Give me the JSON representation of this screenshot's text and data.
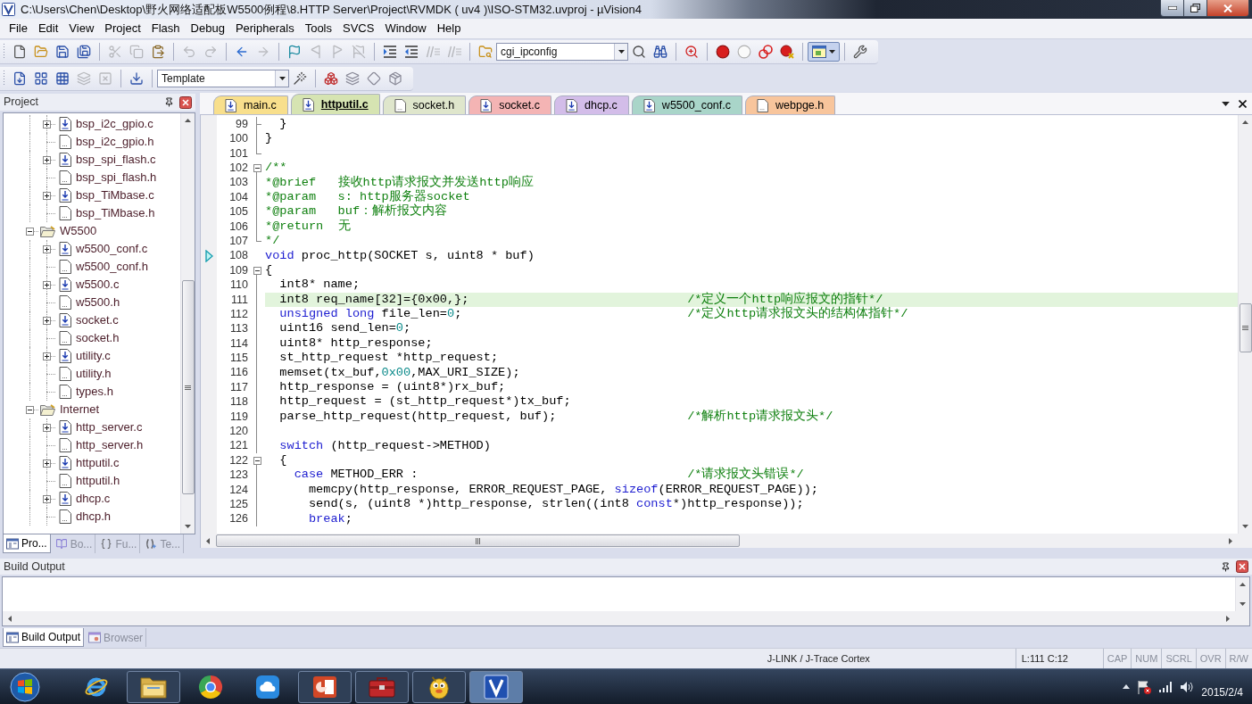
{
  "window": {
    "title": "C:\\Users\\Chen\\Desktop\\野火网络适配板W5500例程\\8.HTTP Server\\Project\\RVMDK ( uv4 )\\ISO-STM32.uvproj - µVision4"
  },
  "menu": [
    "File",
    "Edit",
    "View",
    "Project",
    "Flash",
    "Debug",
    "Peripherals",
    "Tools",
    "SVCS",
    "Window",
    "Help"
  ],
  "toolbar_1": [
    {
      "kind": "new",
      "disabled": false,
      "pressed": false
    },
    {
      "kind": "open",
      "disabled": false,
      "pressed": false
    },
    {
      "kind": "save",
      "disabled": false,
      "pressed": false
    },
    {
      "kind": "save_all",
      "disabled": false,
      "pressed": false
    },
    {
      "kind": "separator"
    },
    {
      "kind": "cut",
      "disabled": true,
      "pressed": false
    },
    {
      "kind": "copy",
      "disabled": true,
      "pressed": false
    },
    {
      "kind": "paste",
      "disabled": false,
      "pressed": false
    },
    {
      "kind": "separator"
    },
    {
      "kind": "undo",
      "disabled": true,
      "pressed": false
    },
    {
      "kind": "redo",
      "disabled": true,
      "pressed": false
    },
    {
      "kind": "separator"
    },
    {
      "kind": "back",
      "disabled": false,
      "pressed": false
    },
    {
      "kind": "forward",
      "disabled": true,
      "pressed": false
    },
    {
      "kind": "separator"
    },
    {
      "kind": "bookmark",
      "disabled": false,
      "pressed": false
    },
    {
      "kind": "prev_bookmark",
      "disabled": true,
      "pressed": false
    },
    {
      "kind": "next_bookmark",
      "disabled": true,
      "pressed": false
    },
    {
      "kind": "clear_bookmarks",
      "disabled": true,
      "pressed": false
    },
    {
      "kind": "separator"
    },
    {
      "kind": "indent",
      "disabled": false,
      "pressed": false
    },
    {
      "kind": "unindent",
      "disabled": false,
      "pressed": false
    },
    {
      "kind": "comment",
      "disabled": true,
      "pressed": false
    },
    {
      "kind": "uncomment",
      "disabled": true,
      "pressed": false
    },
    {
      "kind": "separator"
    },
    {
      "kind": "find_in_files",
      "disabled": false,
      "pressed": false
    },
    {
      "kind": "combo",
      "value": "cgi_ipconfig"
    },
    {
      "kind": "find",
      "disabled": false,
      "pressed": false
    },
    {
      "kind": "incremental_find",
      "disabled": false,
      "pressed": false
    },
    {
      "kind": "separator"
    },
    {
      "kind": "debug",
      "disabled": false,
      "pressed": false
    },
    {
      "kind": "separator"
    },
    {
      "kind": "breakpoint",
      "disabled": false,
      "pressed": false
    },
    {
      "kind": "disable_breakpoint",
      "disabled": false,
      "pressed": false
    },
    {
      "kind": "kill_breakpoints",
      "disabled": false,
      "pressed": false
    },
    {
      "kind": "disable_all_breakpoints",
      "disabled": false,
      "pressed": false
    },
    {
      "kind": "separator"
    },
    {
      "kind": "windows",
      "disabled": false,
      "pressed": true
    },
    {
      "kind": "separator"
    },
    {
      "kind": "configure",
      "disabled": false,
      "pressed": false
    }
  ],
  "toolbar_2": [
    {
      "kind": "translate",
      "disabled": false,
      "pressed": false
    },
    {
      "kind": "build",
      "disabled": false,
      "pressed": false
    },
    {
      "kind": "rebuild",
      "disabled": false,
      "pressed": false
    },
    {
      "kind": "batch_build",
      "disabled": true,
      "pressed": false
    },
    {
      "kind": "stop_build",
      "disabled": true,
      "pressed": false
    },
    {
      "kind": "separator"
    },
    {
      "kind": "download",
      "disabled": false,
      "pressed": false
    },
    {
      "kind": "separator"
    },
    {
      "kind": "combo",
      "value": "Template"
    },
    {
      "kind": "options",
      "disabled": false,
      "pressed": false
    },
    {
      "kind": "separator"
    },
    {
      "kind": "components",
      "disabled": false,
      "pressed": false
    },
    {
      "kind": "stack",
      "disabled": false,
      "pressed": false
    },
    {
      "kind": "diamond",
      "disabled": false,
      "pressed": false
    },
    {
      "kind": "package",
      "disabled": false,
      "pressed": false
    }
  ],
  "project_panel": {
    "title": "Project",
    "tree": [
      {
        "children": [
          {
            "kind": "source",
            "label": "bsp_i2c_gpio.c",
            "expanded": false
          },
          {
            "kind": "header",
            "label": "bsp_i2c_gpio.h"
          },
          {
            "kind": "source",
            "label": "bsp_spi_flash.c",
            "expanded": false
          },
          {
            "kind": "header",
            "label": "bsp_spi_flash.h"
          },
          {
            "kind": "source",
            "label": "bsp_TiMbase.c",
            "expanded": false
          },
          {
            "kind": "header",
            "label": "bsp_TiMbase.h"
          }
        ]
      },
      {
        "kind": "group",
        "label": "W5500",
        "expanded": true,
        "children": [
          {
            "kind": "source",
            "label": "w5500_conf.c",
            "expanded": false
          },
          {
            "kind": "header",
            "label": "w5500_conf.h"
          },
          {
            "kind": "source",
            "label": "w5500.c",
            "expanded": false
          },
          {
            "kind": "header",
            "label": "w5500.h"
          },
          {
            "kind": "source",
            "label": "socket.c",
            "expanded": false
          },
          {
            "kind": "header",
            "label": "socket.h"
          },
          {
            "kind": "source",
            "label": "utility.c",
            "expanded": false
          },
          {
            "kind": "header",
            "label": "utility.h"
          },
          {
            "kind": "header",
            "label": "types.h"
          }
        ]
      },
      {
        "kind": "group",
        "label": "Internet",
        "expanded": true,
        "children": [
          {
            "kind": "source",
            "label": "http_server.c",
            "expanded": false
          },
          {
            "kind": "header",
            "label": "http_server.h"
          },
          {
            "kind": "source",
            "label": "httputil.c",
            "expanded": false
          },
          {
            "kind": "header",
            "label": "httputil.h"
          },
          {
            "kind": "source",
            "label": "dhcp.c",
            "expanded": false
          },
          {
            "kind": "header",
            "label": "dhcp.h"
          }
        ]
      }
    ],
    "tabs": [
      {
        "kind": "project",
        "label": "Pro...",
        "selected": true
      },
      {
        "kind": "books",
        "label": "Bo...",
        "selected": false
      },
      {
        "kind": "functions",
        "label": "Fu...",
        "selected": false
      },
      {
        "kind": "templates",
        "label": "Te...",
        "selected": false
      }
    ]
  },
  "editor": {
    "tabs": [
      {
        "kind": "source",
        "label": "main.c",
        "color": "#f8df8c",
        "selected": false
      },
      {
        "kind": "source",
        "label": "httputil.c",
        "color": "#d6e4b2",
        "selected": true
      },
      {
        "kind": "header",
        "label": "socket.h",
        "color": "#dfe6cc",
        "selected": false
      },
      {
        "kind": "source",
        "label": "socket.c",
        "color": "#f4b4b4",
        "selected": false
      },
      {
        "kind": "source",
        "label": "dhcp.c",
        "color": "#d3bde9",
        "selected": false
      },
      {
        "kind": "source",
        "label": "w5500_conf.c",
        "color": "#a9d5c9",
        "selected": false
      },
      {
        "kind": "header",
        "label": "webpge.h",
        "color": "#f8c59c",
        "selected": false
      }
    ],
    "lines": [
      {
        "number": "99",
        "fold": {
          "kind": "tick"
        },
        "marker": false,
        "highlighted": false,
        "code": [
          {
            "kind": "plain",
            "text": "  }"
          }
        ]
      },
      {
        "number": "100",
        "fold": {
          "kind": "inner"
        },
        "marker": false,
        "highlighted": false,
        "code": [
          {
            "kind": "plain",
            "text": "}"
          }
        ]
      },
      {
        "number": "101",
        "fold": {
          "kind": "end"
        },
        "marker": false,
        "highlighted": false
      },
      {
        "number": "102",
        "fold": {
          "kind": "open",
          "expanded": true
        },
        "marker": false,
        "highlighted": false,
        "code": [
          {
            "kind": "comment",
            "text": "/**"
          }
        ]
      },
      {
        "number": "103",
        "fold": {
          "kind": "inner"
        },
        "marker": false,
        "highlighted": false,
        "code": [
          {
            "kind": "comment",
            "text": "*@brief   接收http请求报文并发送http响应"
          }
        ]
      },
      {
        "number": "104",
        "fold": {
          "kind": "inner"
        },
        "marker": false,
        "highlighted": false,
        "code": [
          {
            "kind": "comment",
            "text": "*@param   s: http服务器socket"
          }
        ]
      },
      {
        "number": "105",
        "fold": {
          "kind": "inner"
        },
        "marker": false,
        "highlighted": false,
        "code": [
          {
            "kind": "comment",
            "text": "*@param   buf：解析报文内容"
          }
        ]
      },
      {
        "number": "106",
        "fold": {
          "kind": "inner"
        },
        "marker": false,
        "highlighted": false,
        "code": [
          {
            "kind": "comment",
            "text": "*@return  无"
          }
        ]
      },
      {
        "number": "107",
        "fold": {
          "kind": "end"
        },
        "marker": false,
        "highlighted": false,
        "code": [
          {
            "kind": "comment",
            "text": "*/"
          }
        ]
      },
      {
        "number": "108",
        "marker": true,
        "highlighted": false,
        "code": [
          {
            "kind": "keyword",
            "text": "void"
          },
          {
            "kind": "plain",
            "text": " proc_http(SOCKET s, uint8 * buf)"
          }
        ]
      },
      {
        "number": "109",
        "fold": {
          "kind": "open",
          "expanded": true
        },
        "marker": false,
        "highlighted": false,
        "code": [
          {
            "kind": "plain",
            "text": "{"
          }
        ]
      },
      {
        "number": "110",
        "fold": {
          "kind": "inner"
        },
        "marker": false,
        "highlighted": false,
        "code": [
          {
            "kind": "plain",
            "text": "  int8* name;"
          }
        ]
      },
      {
        "number": "111",
        "fold": {
          "kind": "inner"
        },
        "marker": false,
        "highlighted": true,
        "code": [
          {
            "kind": "plain",
            "text": "  int8 req_name[32]={0x00,};"
          }
        ],
        "comment": "/*定义一个http响应报文的指针*/"
      },
      {
        "number": "112",
        "fold": {
          "kind": "inner"
        },
        "marker": false,
        "highlighted": false,
        "code": [
          {
            "kind": "keyword",
            "text": "  unsigned long"
          },
          {
            "kind": "plain",
            "text": " file_len="
          },
          {
            "kind": "number",
            "text": "0"
          },
          {
            "kind": "plain",
            "text": ";"
          }
        ],
        "comment": "/*定义http请求报文头的结构体指针*/"
      },
      {
        "number": "113",
        "fold": {
          "kind": "inner"
        },
        "marker": false,
        "highlighted": false,
        "code": [
          {
            "kind": "plain",
            "text": "  uint16 send_len="
          },
          {
            "kind": "number",
            "text": "0"
          },
          {
            "kind": "plain",
            "text": ";"
          }
        ]
      },
      {
        "number": "114",
        "fold": {
          "kind": "inner"
        },
        "marker": false,
        "highlighted": false,
        "code": [
          {
            "kind": "plain",
            "text": "  uint8* http_response;"
          }
        ]
      },
      {
        "number": "115",
        "fold": {
          "kind": "inner"
        },
        "marker": false,
        "highlighted": false,
        "code": [
          {
            "kind": "plain",
            "text": "  st_http_request *http_request;"
          }
        ]
      },
      {
        "number": "116",
        "fold": {
          "kind": "inner"
        },
        "marker": false,
        "highlighted": false,
        "code": [
          {
            "kind": "plain",
            "text": "  memset(tx_buf,"
          },
          {
            "kind": "number",
            "text": "0x00"
          },
          {
            "kind": "plain",
            "text": ",MAX_URI_SIZE);"
          }
        ]
      },
      {
        "number": "117",
        "fold": {
          "kind": "inner"
        },
        "marker": false,
        "highlighted": false,
        "code": [
          {
            "kind": "plain",
            "text": "  http_response = (uint8*)rx_buf;"
          }
        ]
      },
      {
        "number": "118",
        "fold": {
          "kind": "inner"
        },
        "marker": false,
        "highlighted": false,
        "code": [
          {
            "kind": "plain",
            "text": "  http_request = (st_http_request*)tx_buf;"
          }
        ]
      },
      {
        "number": "119",
        "fold": {
          "kind": "inner"
        },
        "marker": false,
        "highlighted": false,
        "code": [
          {
            "kind": "plain",
            "text": "  parse_http_request(http_request, buf);"
          }
        ],
        "comment": "/*解析http请求报文头*/"
      },
      {
        "number": "120",
        "fold": {
          "kind": "inner"
        },
        "marker": false,
        "highlighted": false
      },
      {
        "number": "121",
        "fold": {
          "kind": "inner"
        },
        "marker": false,
        "highlighted": false,
        "code": [
          {
            "kind": "keyword",
            "text": "  switch"
          },
          {
            "kind": "plain",
            "text": " (http_request->METHOD)"
          }
        ]
      },
      {
        "number": "122",
        "fold": {
          "kind": "open",
          "expanded": true
        },
        "marker": false,
        "highlighted": false,
        "code": [
          {
            "kind": "plain",
            "text": "  {"
          }
        ]
      },
      {
        "number": "123",
        "fold": {
          "kind": "inner"
        },
        "marker": false,
        "highlighted": false,
        "code": [
          {
            "kind": "keyword",
            "text": "    case"
          },
          {
            "kind": "plain",
            "text": " METHOD_ERR :"
          }
        ],
        "comment": "/*请求报文头错误*/"
      },
      {
        "number": "124",
        "fold": {
          "kind": "inner"
        },
        "marker": false,
        "highlighted": false,
        "code": [
          {
            "kind": "plain",
            "text": "      memcpy(http_response, ERROR_REQUEST_PAGE, "
          },
          {
            "kind": "keyword",
            "text": "sizeof"
          },
          {
            "kind": "plain",
            "text": "(ERROR_REQUEST_PAGE));"
          }
        ]
      },
      {
        "number": "125",
        "fold": {
          "kind": "inner"
        },
        "marker": false,
        "highlighted": false,
        "code": [
          {
            "kind": "plain",
            "text": "      send(s, (uint8 *)http_response, strlen((int8 "
          },
          {
            "kind": "keyword",
            "text": "const"
          },
          {
            "kind": "plain",
            "text": "*)http_response));"
          }
        ]
      },
      {
        "number": "126",
        "fold": {
          "kind": "inner"
        },
        "marker": false,
        "highlighted": false,
        "code": [
          {
            "kind": "keyword",
            "text": "      break"
          },
          {
            "kind": "plain",
            "text": ";"
          }
        ]
      }
    ]
  },
  "build_output": {
    "title": "Build Output",
    "tabs": [
      {
        "kind": "build",
        "label": "Build Output",
        "selected": true
      },
      {
        "kind": "browser",
        "label": "Browser",
        "selected": false
      }
    ]
  },
  "status_bar": {
    "target": "J-LINK / J-Trace Cortex",
    "position": "L:111 C:12",
    "indicators": [
      {
        "label": "CAP",
        "on": false
      },
      {
        "label": "NUM",
        "on": false
      },
      {
        "label": "SCRL",
        "on": false
      },
      {
        "label": "OVR",
        "on": false
      },
      {
        "label": "R/W",
        "on": false
      }
    ]
  },
  "taskbar": {
    "apps": [
      {
        "kind": "ie",
        "running": false,
        "selected": false
      },
      {
        "kind": "explorer",
        "running": true,
        "selected": false
      },
      {
        "kind": "chrome",
        "running": false,
        "selected": false
      },
      {
        "kind": "cloud",
        "running": false,
        "selected": false
      },
      {
        "kind": "powerpoint",
        "running": true,
        "selected": false
      },
      {
        "kind": "toolbox",
        "running": true,
        "selected": false
      },
      {
        "kind": "mascot",
        "running": true,
        "selected": false
      },
      {
        "kind": "keil",
        "running": true,
        "selected": true
      }
    ],
    "date": "2015/2/4"
  }
}
